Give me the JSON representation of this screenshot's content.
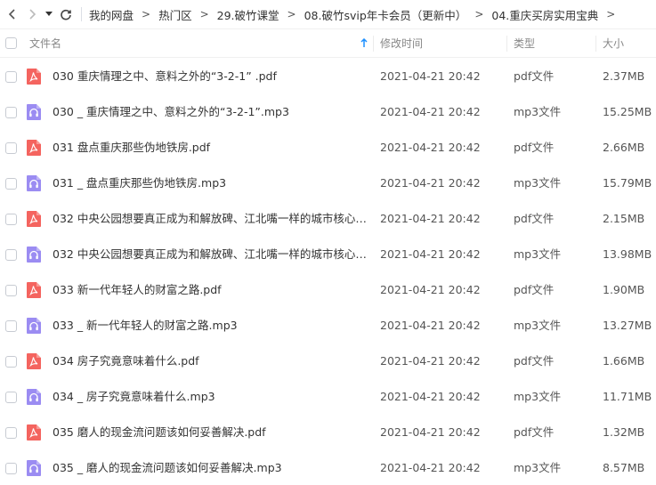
{
  "nav": {
    "breadcrumbs": [
      "我的网盘",
      "热门区",
      "29.破竹课堂",
      "08.破竹svip年卡会员（更新中）",
      "04.重庆买房实用宝典"
    ],
    "trailing_arrow": ">"
  },
  "header": {
    "name": "文件名",
    "time": "修改时间",
    "type": "类型",
    "size": "大小",
    "sort": "ascending"
  },
  "colors": {
    "pdf": "#f4645f",
    "mp3": "#9b8cf2",
    "sort_arrow": "#1e90ff"
  },
  "files": [
    {
      "name": "030  重庆情理之中、意料之外的“3-2-1”  .pdf",
      "time": "2021-04-21 20:42",
      "type": "pdf文件",
      "size": "2.37MB",
      "kind": "pdf"
    },
    {
      "name": "030 _ 重庆情理之中、意料之外的“3-2-1”.mp3",
      "time": "2021-04-21 20:42",
      "type": "mp3文件",
      "size": "15.25MB",
      "kind": "mp3"
    },
    {
      "name": "031  盘点重庆那些伪地铁房.pdf",
      "time": "2021-04-21 20:42",
      "type": "pdf文件",
      "size": "2.66MB",
      "kind": "pdf"
    },
    {
      "name": "031 _ 盘点重庆那些伪地铁房.mp3",
      "time": "2021-04-21 20:42",
      "type": "mp3文件",
      "size": "15.79MB",
      "kind": "mp3"
    },
    {
      "name": "032  中央公园想要真正成为和解放碑、江北嘴一样的城市核心，...",
      "time": "2021-04-21 20:42",
      "type": "pdf文件",
      "size": "2.15MB",
      "kind": "pdf"
    },
    {
      "name": "032 中央公园想要真正成为和解放碑、江北嘴一样的城市核心，...",
      "time": "2021-04-21 20:42",
      "type": "mp3文件",
      "size": "13.98MB",
      "kind": "mp3"
    },
    {
      "name": "033  新一代年轻人的财富之路.pdf",
      "time": "2021-04-21 20:42",
      "type": "pdf文件",
      "size": "1.90MB",
      "kind": "pdf"
    },
    {
      "name": "033 _ 新一代年轻人的财富之路.mp3",
      "time": "2021-04-21 20:42",
      "type": "mp3文件",
      "size": "13.27MB",
      "kind": "mp3"
    },
    {
      "name": "034  房子究竟意味着什么.pdf",
      "time": "2021-04-21 20:42",
      "type": "pdf文件",
      "size": "1.66MB",
      "kind": "pdf"
    },
    {
      "name": "034 _ 房子究竟意味着什么.mp3",
      "time": "2021-04-21 20:42",
      "type": "mp3文件",
      "size": "11.71MB",
      "kind": "mp3"
    },
    {
      "name": "035  磨人的现金流问题该如何妥善解决.pdf",
      "time": "2021-04-21 20:42",
      "type": "pdf文件",
      "size": "1.32MB",
      "kind": "pdf"
    },
    {
      "name": "035 _ 磨人的现金流问题该如何妥善解决.mp3",
      "time": "2021-04-21 20:42",
      "type": "mp3文件",
      "size": "8.57MB",
      "kind": "mp3"
    }
  ]
}
